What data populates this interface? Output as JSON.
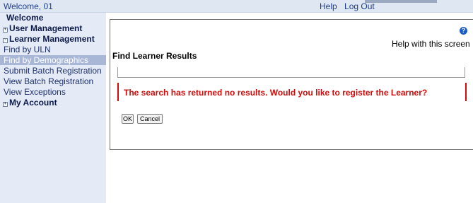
{
  "topbar": {
    "welcome": "Welcome, 01",
    "help": "Help",
    "logout": "Log Out"
  },
  "sidebar": {
    "items": [
      {
        "label": "Welcome"
      },
      {
        "label": "User Management",
        "expander": "+"
      },
      {
        "label": "Learner Management",
        "expander": "-"
      },
      {
        "label": "Find by ULN"
      },
      {
        "label": "Find by Demographics"
      },
      {
        "label": "Submit Batch Registration"
      },
      {
        "label": "View Batch Registration"
      },
      {
        "label": "View Exceptions"
      },
      {
        "label": "My Account",
        "expander": "+"
      }
    ]
  },
  "main": {
    "help_icon": "question-circle-icon",
    "help_link": "Help with this screen",
    "title": "Find Learner Results",
    "error": "The search has returned no results. Would you like to register the Learner?",
    "ok_label": "OK",
    "cancel_label": "Cancel"
  },
  "colors": {
    "topbar_bg": "#dfe7f3",
    "sidebar_bg": "#e4ebf6",
    "active_item": "#a9b7d6",
    "error_red": "#d20a0a",
    "link_blue": "#1f3d8a"
  }
}
